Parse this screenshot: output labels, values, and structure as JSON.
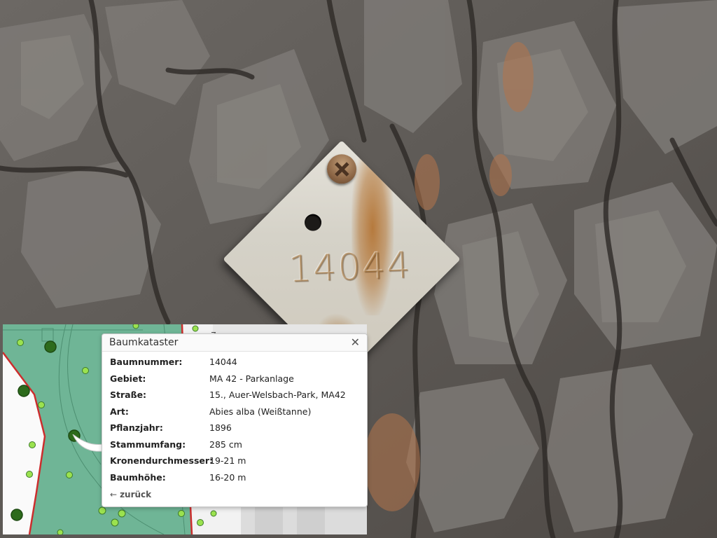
{
  "tag": {
    "number": "14044"
  },
  "map": {
    "street_label": "ra"
  },
  "popup": {
    "title": "Baumkataster",
    "close_label": "✕",
    "rows": [
      {
        "label": "Baumnummer:",
        "value": "14044"
      },
      {
        "label": "Gebiet:",
        "value": "MA 42 - Parkanlage"
      },
      {
        "label": "Straße:",
        "value": "15., Auer-Welsbach-Park, MA42"
      },
      {
        "label": "Art:",
        "value": "Abies alba (Weißtanne)"
      },
      {
        "label": "Pflanzjahr:",
        "value": "1896"
      },
      {
        "label": "Stammumfang:",
        "value": "285 cm"
      },
      {
        "label": "Kronendurchmesser:",
        "value": "19-21 m"
      },
      {
        "label": "Baumhöhe:",
        "value": "16-20 m"
      }
    ],
    "back_label": "zurück",
    "back_icon": "arrow-left-icon"
  },
  "colors": {
    "park_green": "#6fb596",
    "tree_dot_light": "#9be24f",
    "tree_dot_dark": "#2d6b1c",
    "boundary_red": "#cc2d2d",
    "bark_base": "#5f5b57"
  }
}
